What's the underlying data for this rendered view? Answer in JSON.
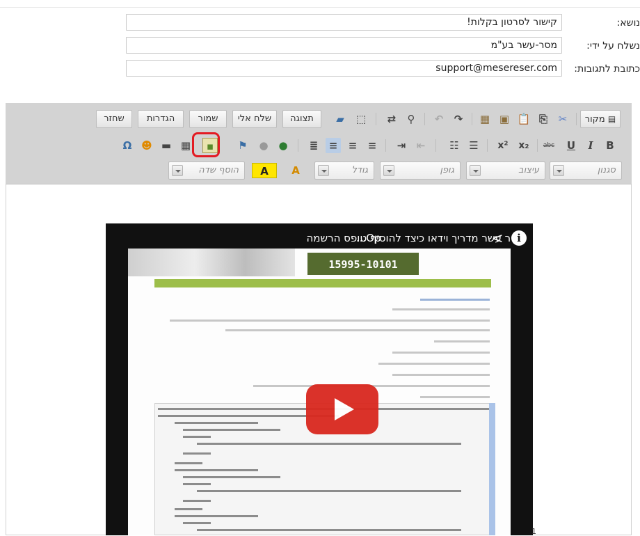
{
  "form": {
    "subject": {
      "label": "נושא:",
      "value": "קישור לסרטון בקלות!"
    },
    "sender": {
      "label": "נשלח על ידי:",
      "value": "מסר-עשר בע\"מ"
    },
    "reply_to": {
      "label": "כתובת לתגובות:",
      "value": "support@mesereser.com"
    }
  },
  "toolbar": {
    "row1": {
      "source": "מקור",
      "preview": "תצוגה",
      "send_to_me": "שלח אלי",
      "save": "שמור",
      "settings": "הגדרות",
      "restore": "שחזר"
    },
    "row2_icons": {
      "bold": "B",
      "italic": "I",
      "underline": "U",
      "strike": "abc",
      "subscript": "x₂",
      "superscript": "x²",
      "special_char": "Ω"
    },
    "row3": {
      "style": "סגנון",
      "format": "עיצוב",
      "font": "גופן",
      "size": "גודל",
      "add_field": "הוסף שדה",
      "text_color": "A",
      "bg_color": "A"
    }
  },
  "video": {
    "title": "מסר עשר   מדריך וידאו כיצד להוסיף טופס הרשמה",
    "title_prefix": "...Op",
    "banner_text": "15995-10101",
    "icons": {
      "share": "share-icon",
      "info": "info-icon",
      "play": "play-icon"
    }
  },
  "page_number": "1",
  "colors": {
    "highlight": "#e31b23",
    "toolbar_bg": "#d3d3d3",
    "play": "#d9281f"
  }
}
